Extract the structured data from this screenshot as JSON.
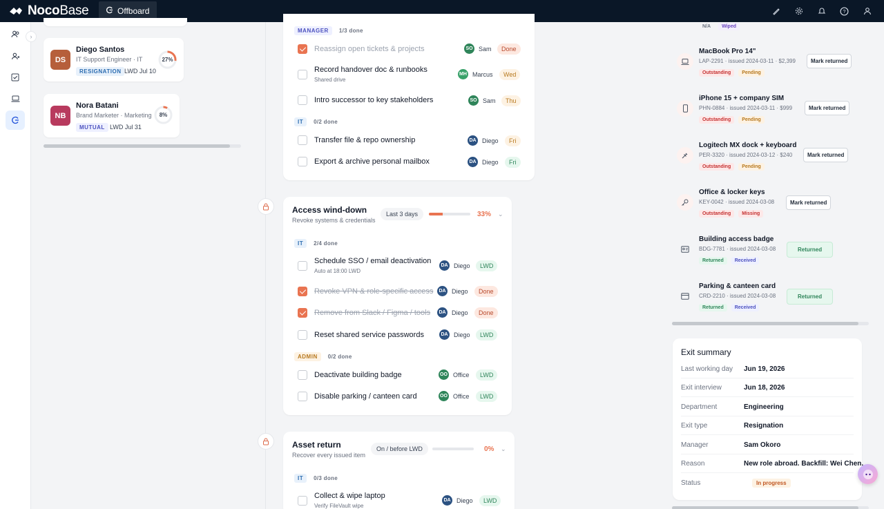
{
  "app": {
    "brand_bold": "Noco",
    "brand_light": "Base",
    "active_tab": "Offboard"
  },
  "employees": [
    {
      "initials": "DS",
      "name": "Diego Santos",
      "role": "IT Support Engineer · IT",
      "tag": "RESIGNATION",
      "lwd": "LWD Jul 10",
      "progress": "27%",
      "progress_value": 0.27,
      "color": "#b65f3b"
    },
    {
      "initials": "NB",
      "name": "Nora Batani",
      "role": "Brand Marketer · Marketing",
      "tag": "MUTUAL",
      "lwd": "LWD Jul 31",
      "progress": "8%",
      "progress_value": 0.08,
      "color": "#b83a5e"
    }
  ],
  "stage1": {
    "group_manager": {
      "tag": "MANAGER",
      "done": "1/3 done"
    },
    "tasks_manager": [
      {
        "label": "Reassign open tickets & projects",
        "assignee": "Sam",
        "initials": "SO",
        "due": "Done"
      },
      {
        "label": "Record handover doc & runbooks",
        "sub": "Shared drive",
        "assignee": "Marcus",
        "initials": "MH",
        "due": "Wed"
      },
      {
        "label": "Intro successor to key stakeholders",
        "assignee": "Sam",
        "initials": "SO",
        "due": "Thu"
      }
    ],
    "group_it": {
      "tag": "IT",
      "done": "0/2 done"
    },
    "tasks_it": [
      {
        "label": "Transfer file & repo ownership",
        "assignee": "Diego",
        "initials": "DA",
        "due": "Fri"
      },
      {
        "label": "Export & archive personal mailbox",
        "assignee": "Diego",
        "initials": "DA",
        "due": "Fri"
      }
    ]
  },
  "stage2": {
    "title": "Access wind-down",
    "subtitle": "Revoke systems & credentials",
    "when": "Last 3 days",
    "pct": "33%",
    "progress": 0.33,
    "group_it": {
      "tag": "IT",
      "done": "2/4 done"
    },
    "tasks_it": [
      {
        "label": "Schedule SSO / email deactivation",
        "sub": "Auto at 18:00 LWD",
        "assignee": "Diego",
        "initials": "DA",
        "due": "LWD"
      },
      {
        "label": "Revoke VPN & role-specific access",
        "assignee": "Diego",
        "initials": "DA",
        "due": "Done"
      },
      {
        "label": "Remove from Slack / Figma / tools",
        "assignee": "Diego",
        "initials": "DA",
        "due": "Done"
      },
      {
        "label": "Reset shared service passwords",
        "assignee": "Diego",
        "initials": "DA",
        "due": "LWD"
      }
    ],
    "group_admin": {
      "tag": "ADMIN",
      "done": "0/2 done"
    },
    "tasks_admin": [
      {
        "label": "Deactivate building badge",
        "assignee": "Office",
        "initials": "OO",
        "due": "LWD"
      },
      {
        "label": "Disable parking / canteen card",
        "assignee": "Office",
        "initials": "OO",
        "due": "LWD"
      }
    ]
  },
  "stage3": {
    "title": "Asset return",
    "subtitle": "Recover every issued item",
    "when": "On / before LWD",
    "pct": "0%",
    "progress": 0,
    "group_it": {
      "tag": "IT",
      "done": "0/3 done"
    },
    "tasks_it": [
      {
        "label": "Collect & wipe laptop",
        "sub": "Verify FileVault wipe",
        "assignee": "Diego",
        "initials": "DA",
        "due": "LWD"
      }
    ]
  },
  "assets": {
    "top_badges": [
      "N/A",
      "Wiped"
    ],
    "items": [
      {
        "name": "MacBook Pro 14\"",
        "meta": "LAP-2291 · issued 2024-03-11 · $2,399",
        "status": "Outstanding",
        "state": "Pending",
        "action": "Mark returned",
        "icon": "laptop-icon"
      },
      {
        "name": "iPhone 15 + company SIM",
        "meta": "PHN-0884 · issued 2024-03-11 · $999",
        "status": "Outstanding",
        "state": "Pending",
        "action": "Mark returned",
        "icon": "phone-icon"
      },
      {
        "name": "Logitech MX dock + keyboard",
        "meta": "PER-3320 · issued 2024-03-12 · $240",
        "status": "Outstanding",
        "state": "Pending",
        "action": "Mark returned",
        "icon": "plug-icon"
      },
      {
        "name": "Office & locker keys",
        "meta": "KEY-0042 · issued 2024-03-08",
        "status": "Outstanding",
        "state": "Missing",
        "action": "Mark returned",
        "icon": "key-icon"
      },
      {
        "name": "Building access badge",
        "meta": "BDG-7781 · issued 2024-03-08",
        "status": "Returned",
        "state": "Received",
        "action": "Returned",
        "icon": "badge-icon"
      },
      {
        "name": "Parking & canteen card",
        "meta": "CRD-2210 · issued 2024-03-08",
        "status": "Returned",
        "state": "Received",
        "action": "Returned",
        "icon": "card-icon"
      }
    ]
  },
  "summary": {
    "title": "Exit summary",
    "rows": [
      {
        "k": "Last working day",
        "v": "Jun 19, 2026"
      },
      {
        "k": "Exit interview",
        "v": "Jun 18, 2026"
      },
      {
        "k": "Department",
        "v": "Engineering"
      },
      {
        "k": "Exit type",
        "v": "Resignation"
      },
      {
        "k": "Manager",
        "v": "Sam Okoro"
      },
      {
        "k": "Reason",
        "v": "New role abroad. Backfill: Wei Chen."
      }
    ],
    "status_label": "Status",
    "status_value": "In progress"
  }
}
